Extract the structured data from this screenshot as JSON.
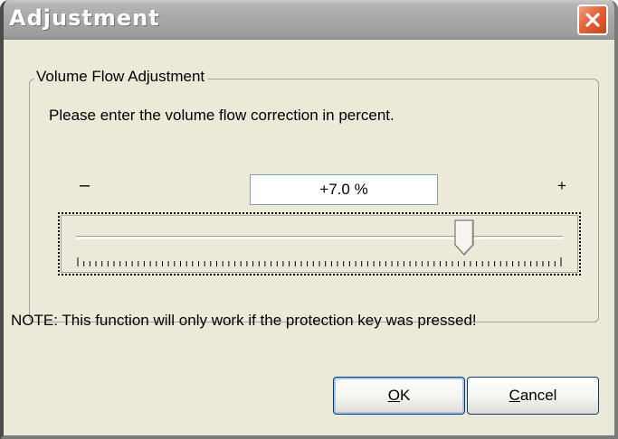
{
  "window": {
    "title": "Adjustment",
    "close_icon": "close-icon"
  },
  "group": {
    "legend": "Volume Flow Adjustment",
    "instruction": "Please enter the volume flow correction in percent."
  },
  "adjustment": {
    "minus_label": "–",
    "plus_label": "+",
    "value_text": "+7.0 %",
    "slider_position": 0.8,
    "tick_count": 80
  },
  "note": "NOTE: This function will only work if the protection key was pressed!",
  "buttons": {
    "ok": {
      "mnemonic": "O",
      "rest": "K"
    },
    "cancel": {
      "mnemonic": "C",
      "rest": "ancel"
    }
  },
  "colors": {
    "dialog_background": "#ece9d8",
    "close_button": "#e4633c",
    "input_border": "#7f9db9",
    "button_border": "#003c74"
  }
}
